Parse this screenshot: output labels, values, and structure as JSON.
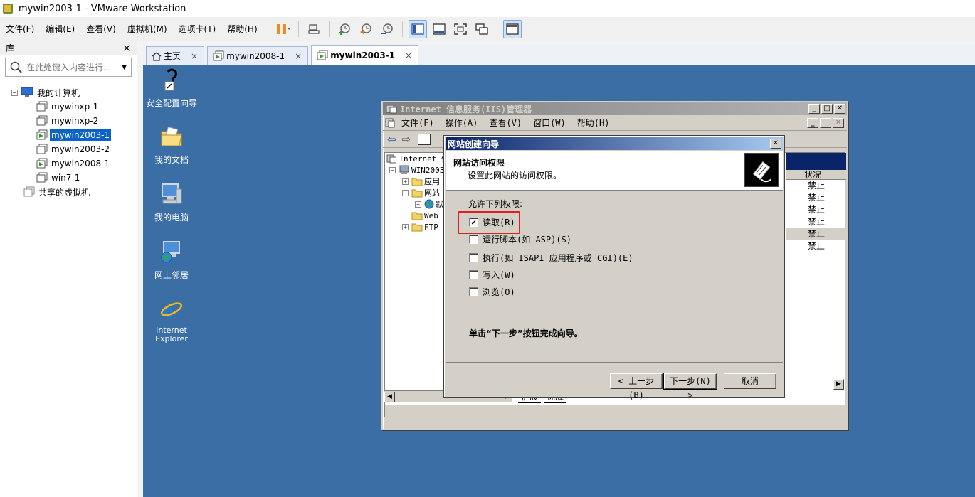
{
  "window": {
    "title": "mywin2003-1 - VMware Workstation"
  },
  "menu": [
    "文件(F)",
    "编辑(E)",
    "查看(V)",
    "虚拟机(M)",
    "选项卡(T)",
    "帮助(H)"
  ],
  "library": {
    "title": "库",
    "close": "×",
    "search_placeholder": "在此处键入内容进行...",
    "tree": {
      "root": "我的计算机",
      "vms": [
        "mywinxp-1",
        "mywinxp-2",
        "mywin2003-1",
        "mywin2003-2",
        "mywin2008-1",
        "win7-1"
      ],
      "shared": "共享的虚拟机",
      "selected_index": 2
    }
  },
  "tabs": [
    {
      "label": "主页",
      "active": false
    },
    {
      "label": "mywin2008-1",
      "active": false
    },
    {
      "label": "mywin2003-1",
      "active": true
    }
  ],
  "tab_close": "×",
  "desktop_icons": [
    {
      "label": "安全配置向导",
      "icon": "security-wizard-icon"
    },
    {
      "label": "我的文档",
      "icon": "my-documents-icon"
    },
    {
      "label": "我的电脑",
      "icon": "my-computer-icon"
    },
    {
      "label": "网上邻居",
      "icon": "network-places-icon"
    },
    {
      "label": "Internet Explorer",
      "icon": "ie-icon"
    }
  ],
  "iis": {
    "title": "Internet 信息服务(IIS)管理器",
    "menu": [
      "文件(F)",
      "操作(A)",
      "查看(V)",
      "窗口(W)",
      "帮助(H)"
    ],
    "tree": [
      "Internet 信",
      "WIN2003",
      "应用",
      "网站",
      "默",
      "Web",
      "FTP"
    ],
    "status_header": "状况",
    "status_values": [
      "禁止",
      "禁止",
      "禁止",
      "禁止",
      "禁止",
      "禁止"
    ],
    "subtabs": [
      "扩展",
      "标准"
    ]
  },
  "wizard": {
    "title": "网站创建向导",
    "heading": "网站访问权限",
    "subheading": "设置此网站的访问权限。",
    "perm_label": "允许下列权限:",
    "permissions": [
      {
        "label": "读取(R)",
        "checked": true
      },
      {
        "label": "运行脚本(如 ASP)(S)",
        "checked": false
      },
      {
        "label": "执行(如 ISAPI 应用程序或 CGI)(E)",
        "checked": false
      },
      {
        "label": "写入(W)",
        "checked": false
      },
      {
        "label": "浏览(O)",
        "checked": false
      }
    ],
    "note": "单击“下一步”按钮完成向导。",
    "buttons": {
      "back": "< 上一步(B)",
      "next": "下一步(N) >",
      "cancel": "取消"
    },
    "check_mark": "✔"
  },
  "colors": {
    "desktop": "#3a6ea5",
    "selection": "#0c63c6",
    "highlight_box": "#e02020",
    "wizard_title": "#0a246a"
  }
}
